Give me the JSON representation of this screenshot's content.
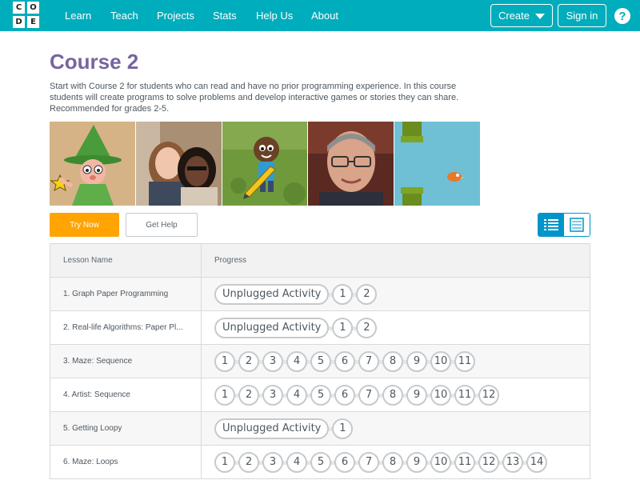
{
  "header": {
    "logo_letters": [
      "C",
      "O",
      "D",
      "E"
    ],
    "nav": [
      "Learn",
      "Teach",
      "Projects",
      "Stats",
      "Help Us",
      "About"
    ],
    "create_label": "Create",
    "signin_label": "Sign in",
    "help_glyph": "?",
    "bg_color": "#00adbc"
  },
  "course": {
    "title": "Course 2",
    "description": "Start with Course 2 for students who can read and have no prior programming experience. In this course students will create programs to solve problems and develop interactive games or stories they can share. Recommended for grades 2-5.",
    "title_color": "#7665a0"
  },
  "actions": {
    "try_now": "Try Now",
    "get_help": "Get Help",
    "accent_color": "#ffa400",
    "view_toggle": [
      "summary-view-icon",
      "detail-view-icon"
    ]
  },
  "table": {
    "headers": [
      "Lesson Name",
      "Progress"
    ],
    "rows": [
      {
        "name": "1. Graph Paper Programming",
        "unplugged": "Unplugged Activity",
        "levels": [
          "1",
          "2"
        ]
      },
      {
        "name": "2. Real-life Algorithms: Paper Pl...",
        "unplugged": "Unplugged Activity",
        "levels": [
          "1",
          "2"
        ]
      },
      {
        "name": "3. Maze: Sequence",
        "unplugged": "",
        "levels": [
          "1",
          "2",
          "3",
          "4",
          "5",
          "6",
          "7",
          "8",
          "9",
          "10",
          "11"
        ]
      },
      {
        "name": "4. Artist: Sequence",
        "unplugged": "",
        "levels": [
          "1",
          "2",
          "3",
          "4",
          "5",
          "6",
          "7",
          "8",
          "9",
          "10",
          "11",
          "12"
        ]
      },
      {
        "name": "5. Getting Loopy",
        "unplugged": "Unplugged Activity",
        "levels": [
          "1"
        ]
      },
      {
        "name": "6. Maze: Loops",
        "unplugged": "",
        "levels": [
          "1",
          "2",
          "3",
          "4",
          "5",
          "6",
          "7",
          "8",
          "9",
          "10",
          "11",
          "12",
          "13",
          "14"
        ]
      }
    ]
  },
  "images": [
    "wizard-cartoon-image",
    "two-girls-photo-image",
    "cartoon-boy-pencil-image",
    "man-portrait-photo-image",
    "flappy-bird-game-image"
  ]
}
